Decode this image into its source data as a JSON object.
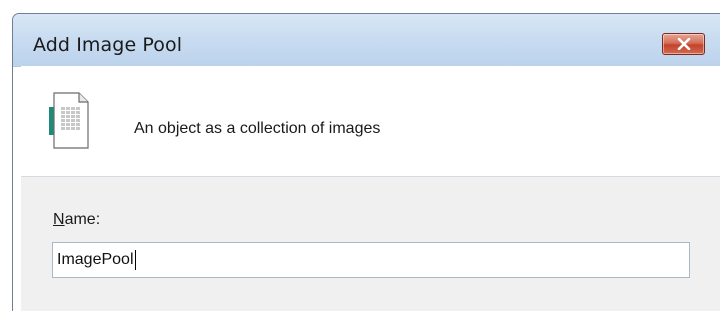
{
  "window": {
    "title": "Add Image Pool"
  },
  "header": {
    "description": "An object as a collection of images",
    "icon": "document-grid-icon"
  },
  "form": {
    "name_label_accel": "N",
    "name_label_rest": "ame:",
    "name_value": "ImagePool"
  },
  "colors": {
    "titlebar": "#c9dcf1",
    "close_button": "#c2432b",
    "body_background": "#f0f0f0",
    "input_border": "#a9b9cc"
  }
}
